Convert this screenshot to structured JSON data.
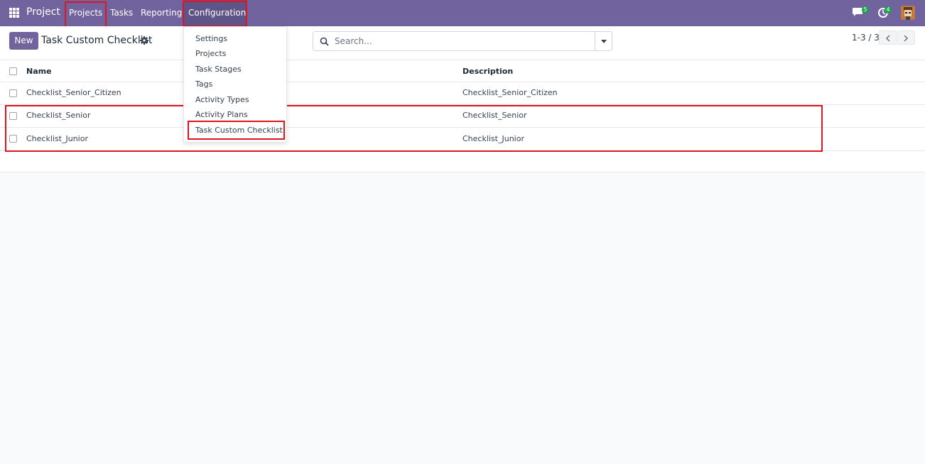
{
  "navbar": {
    "brand": "Project",
    "menu": [
      {
        "label": "Projects"
      },
      {
        "label": "Tasks"
      },
      {
        "label": "Reporting"
      },
      {
        "label": "Configuration"
      }
    ],
    "chat_badge": "5",
    "activity_badge": "4"
  },
  "control": {
    "new_label": "New",
    "breadcrumb": "Task Custom Checklist",
    "search_placeholder": "Search...",
    "pager": "1-3 / 3"
  },
  "config_menu": {
    "items": [
      {
        "label": "Settings"
      },
      {
        "label": "Projects"
      },
      {
        "label": "Task Stages"
      },
      {
        "label": "Tags"
      },
      {
        "label": "Activity Types"
      },
      {
        "label": "Activity Plans"
      },
      {
        "label": "Task Custom Checklist"
      }
    ]
  },
  "list": {
    "columns": {
      "name": "Name",
      "description": "Description"
    },
    "rows": [
      {
        "name": "Checklist_Senior_Citizen",
        "description": "Checklist_Senior_Citizen"
      },
      {
        "name": "Checklist_Senior",
        "description": "Checklist_Senior"
      },
      {
        "name": "Checklist_Junior",
        "description": "Checklist_Junior"
      }
    ]
  },
  "colors": {
    "navbar": "#71639e",
    "highlight": "#e0141e",
    "badge": "#17a34a"
  }
}
